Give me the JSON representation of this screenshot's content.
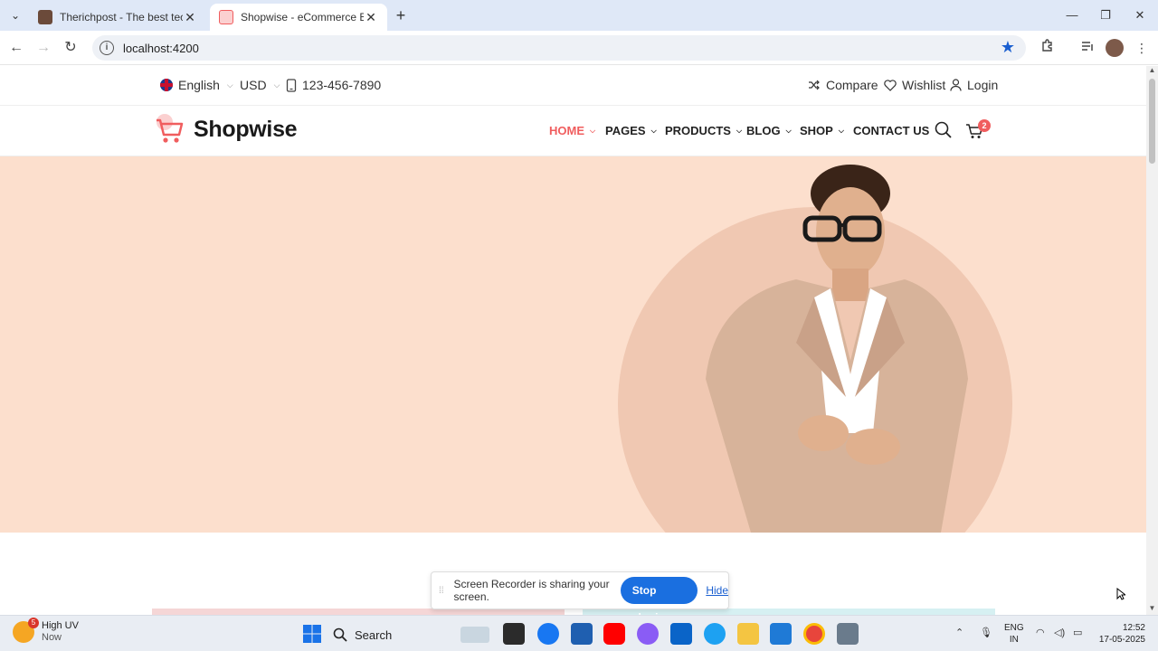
{
  "browser": {
    "tabs": [
      {
        "title": "Therichpost - The best tech and",
        "active": false
      },
      {
        "title": "Shopwise - eCommerce Bootstr",
        "active": true
      }
    ],
    "url": "localhost:4200"
  },
  "site": {
    "topbar": {
      "language": "English",
      "currency": "USD",
      "phone": "123-456-7890",
      "compare": "Compare",
      "wishlist": "Wishlist",
      "login": "Login"
    },
    "brand": "Shopwise",
    "menu": [
      {
        "label": "HOME",
        "active": true
      },
      {
        "label": "PAGES",
        "active": false
      },
      {
        "label": "PRODUCTS",
        "active": false
      },
      {
        "label": "BLOG",
        "active": false
      },
      {
        "label": "SHOP",
        "active": false
      },
      {
        "label": "CONTACT US",
        "active": false
      }
    ],
    "cart_count": "2",
    "colors": {
      "accent": "#f05d5e",
      "hero_bg": "#fcdfcd"
    }
  },
  "share_bar": {
    "message": "Screen Recorder is sharing your screen.",
    "stop": "Stop sharing",
    "hide": "Hide"
  },
  "taskbar": {
    "weather_badge": "5",
    "weather_title": "High UV",
    "weather_sub": "Now",
    "search": "Search",
    "lang_top": "ENG",
    "lang_bottom": "IN",
    "time": "12:52",
    "date": "17-05-2025"
  }
}
